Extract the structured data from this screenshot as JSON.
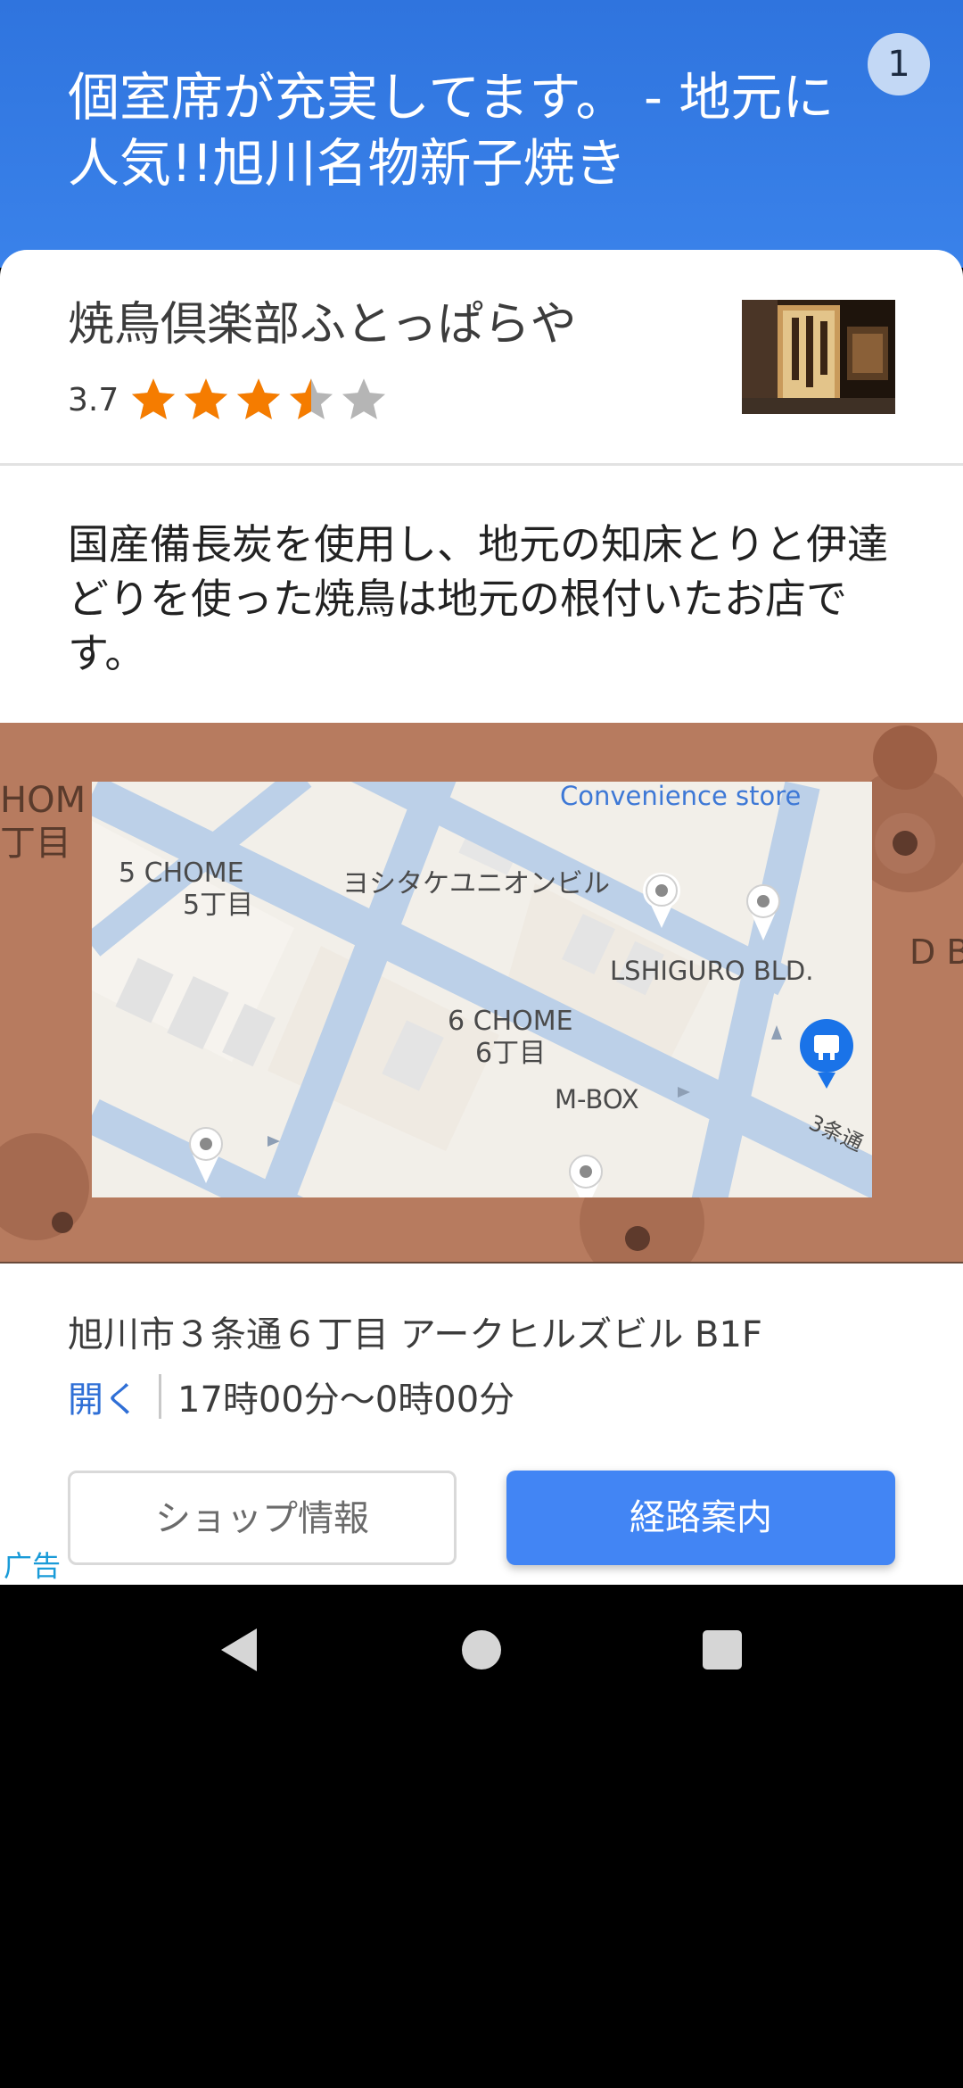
{
  "header": {
    "title": "個室席が充実してます。 - 地元に人気!!旭川名物新子焼き",
    "page_badge": "1"
  },
  "shop": {
    "name": "焼鳥倶楽部ふとっぱらや",
    "rating": "3.7",
    "rating_value": 3.7,
    "rating_max": 5,
    "star_color": "#f57c00",
    "star_empty_color": "#b5b5b5"
  },
  "description": "国産備長炭を使用し、地元の知床とりと伊達どりを使った焼鳥は地元の根付いたお店です。",
  "map": {
    "labels": {
      "convenience_store": "Convenience store",
      "chome5_en": "5 CHOME",
      "chome5_jp": "5丁目",
      "building1": "ヨシタケユニオンビル",
      "lshiguro": "LSHIGURO BLD.",
      "chome6_en": "6 CHOME",
      "chome6_jp": "6丁目",
      "mbox": "M-BOX",
      "street": "3条通",
      "edge_left_en": "HOM",
      "edge_left_jp": "丁目",
      "edge_right": "D BL"
    }
  },
  "info": {
    "address": "旭川市３条通６丁目 アークヒルズビル B1F",
    "open_label": "開く",
    "hours": "17時00分〜0時00分"
  },
  "buttons": {
    "shop_info": "ショップ情報",
    "route": "経路案内"
  },
  "ad_label": "广告",
  "colors": {
    "header_bg": "#2f74de",
    "primary": "#4285f4",
    "link": "#2f6fd6"
  }
}
